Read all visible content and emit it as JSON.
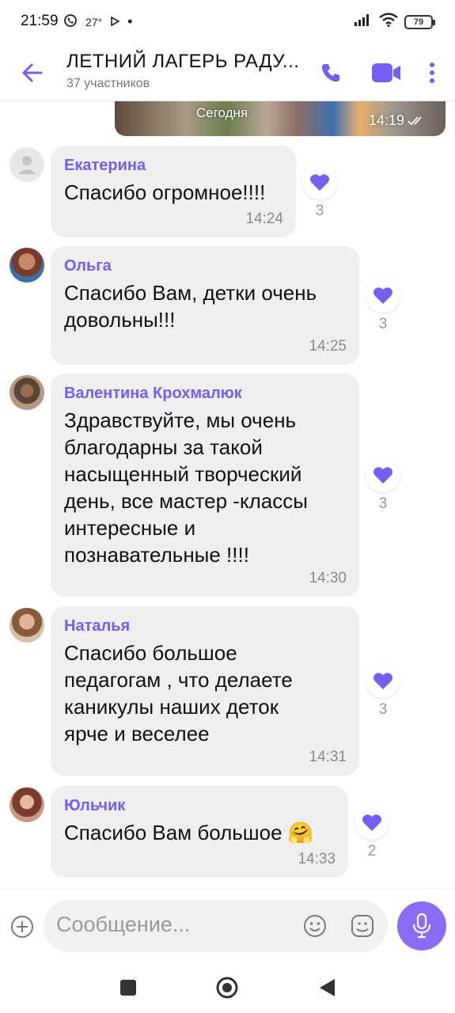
{
  "status_bar": {
    "time": "21:59",
    "temp": "27°",
    "battery": "79"
  },
  "header": {
    "title": "ЛЕТНИЙ ЛАГЕРЬ РАДУ...",
    "subtitle": "37 участников",
    "icons": [
      "back-arrow-icon",
      "phone-icon",
      "video-icon",
      "more-vertical-icon"
    ]
  },
  "media": {
    "date_label": "Сегодня",
    "time": "14:19"
  },
  "messages": [
    {
      "sender": "Екатерина",
      "text": "Спасибо огромное!!!!",
      "time": "14:24",
      "likes": "3"
    },
    {
      "sender": "Ольга",
      "text": "Спасибо Вам, детки очень\nдовольны!!!",
      "time": "14:25",
      "likes": "3"
    },
    {
      "sender": "Валентина Крохмалюк",
      "text": "Здравствуйте, мы очень\nблагодарны за такой\nнасыщенный творческий\nдень, все мастер -классы\nинтересные и\nпознавательные !!!!",
      "time": "14:30",
      "likes": "3"
    },
    {
      "sender": "Наталья",
      "text": "Спасибо большое\nпедагогам , что делаете\nканикулы наших деток\nярче и веселее",
      "time": "14:31",
      "likes": "3"
    },
    {
      "sender": "Юльчик",
      "text": "Спасибо Вам большое 🤗",
      "time": "14:33",
      "likes": "2"
    }
  ],
  "composer": {
    "placeholder": "Сообщение..."
  },
  "colors": {
    "accent": "#7360f2",
    "bubble": "#efefef",
    "heart": "#7360f2"
  }
}
